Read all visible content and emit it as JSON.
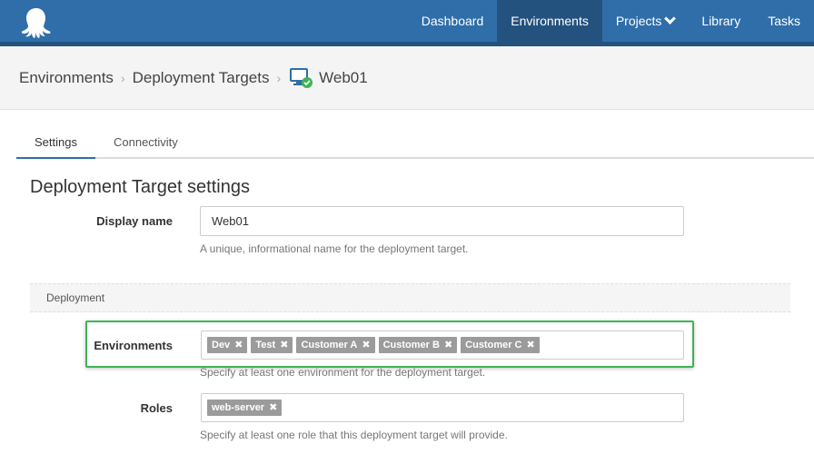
{
  "nav": {
    "items": [
      {
        "label": "Dashboard"
      },
      {
        "label": "Environments"
      },
      {
        "label": "Projects"
      },
      {
        "label": "Library"
      },
      {
        "label": "Tasks"
      }
    ]
  },
  "breadcrumb": {
    "items": [
      "Environments",
      "Deployment Targets"
    ],
    "current": "Web01"
  },
  "tabs": [
    {
      "label": "Settings"
    },
    {
      "label": "Connectivity"
    }
  ],
  "form": {
    "title": "Deployment Target settings",
    "display_name": {
      "label": "Display name",
      "value": "Web01",
      "help": "A unique, informational name for the deployment target."
    },
    "deployment_section": "Deployment",
    "environments": {
      "label": "Environments",
      "tags": [
        "Dev",
        "Test",
        "Customer A",
        "Customer B",
        "Customer C"
      ],
      "help": "Specify at least one environment for the deployment target."
    },
    "roles": {
      "label": "Roles",
      "tags": [
        "web-server"
      ],
      "help": "Specify at least one role that this deployment target will provide."
    }
  },
  "colors": {
    "nav_bg": "#2f6ea8",
    "nav_active": "#23527f",
    "highlight_border": "#3db455",
    "tag_bg": "#9b9b9b"
  },
  "icons": {
    "logo": "octopus-logo",
    "target": "monitor-check-icon",
    "tag_remove": "close-icon",
    "dropdown": "chevron-down-icon"
  }
}
